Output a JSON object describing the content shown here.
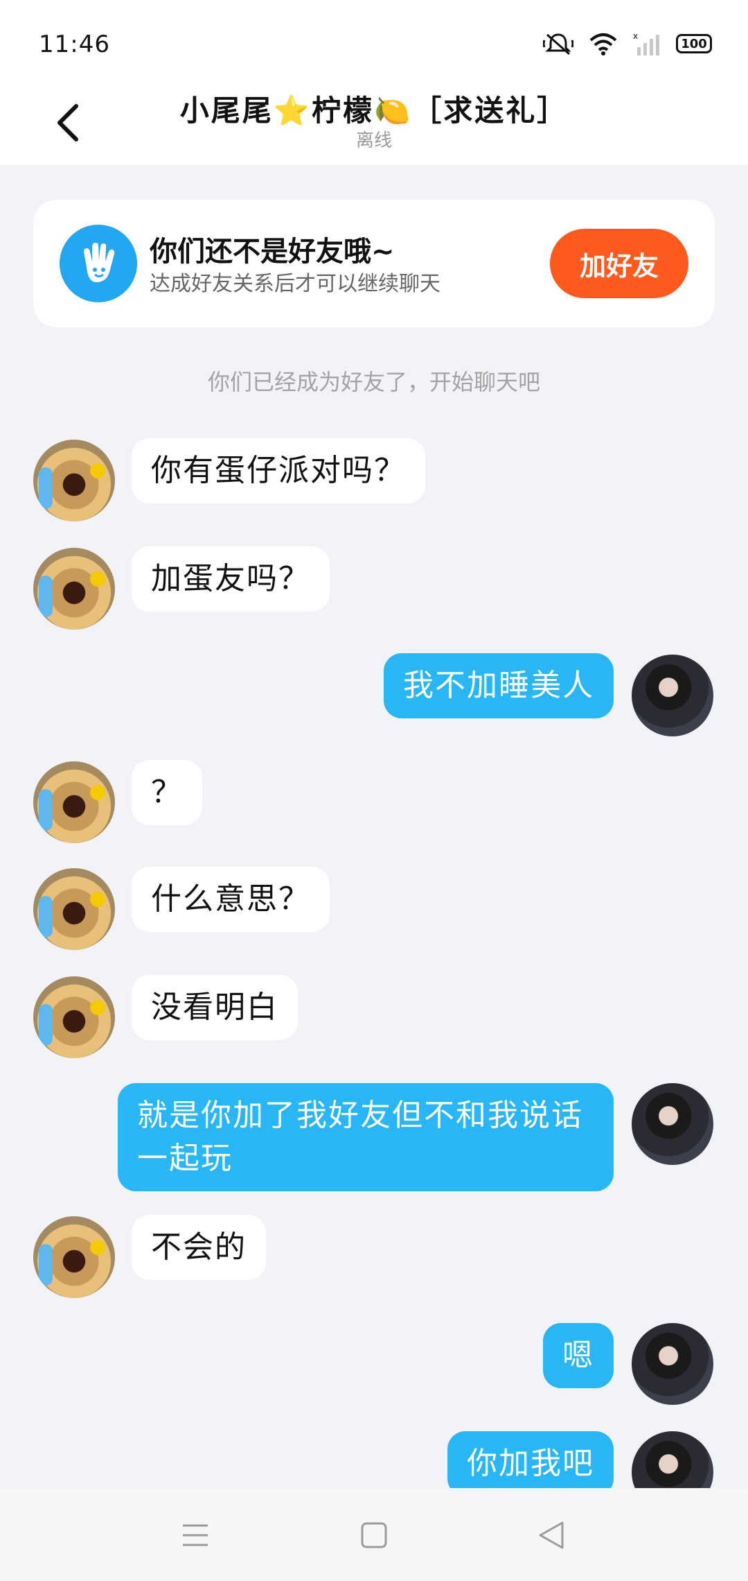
{
  "status_bar": {
    "time": "11:46",
    "battery": "100"
  },
  "header": {
    "back_icon": "chevron-left-icon",
    "title": "小尾尾⭐柠檬🍋［求送礼］",
    "status": "离线"
  },
  "banner": {
    "title": "你们还不是好友哦~",
    "subtitle": "达成好友关系后才可以继续聊天",
    "button_label": "加好友",
    "icon": "hand-icon",
    "button_color": "#fe5a1e"
  },
  "system_message": "你们已经成为好友了，开始聊天吧",
  "messages": [
    {
      "sender": "other",
      "text": "你有蛋仔派对吗？"
    },
    {
      "sender": "other",
      "text": "加蛋友吗？"
    },
    {
      "sender": "me",
      "text": "我不加睡美人"
    },
    {
      "sender": "other",
      "text": "？"
    },
    {
      "sender": "other",
      "text": "什么意思？"
    },
    {
      "sender": "other",
      "text": "没看明白"
    },
    {
      "sender": "me",
      "text": "就是你加了我好友但不和我说话一起玩"
    },
    {
      "sender": "other",
      "text": "不会的"
    },
    {
      "sender": "me",
      "text": "嗯"
    },
    {
      "sender": "me",
      "text": "你加我吧"
    }
  ],
  "colors": {
    "outgoing_bubble": "#28b6f6",
    "incoming_bubble": "#ffffff",
    "background": "#f2f3f7"
  },
  "nav_bar": {
    "menu_icon": "menu-icon",
    "home_icon": "square-home-icon",
    "back_icon": "triangle-back-icon"
  }
}
